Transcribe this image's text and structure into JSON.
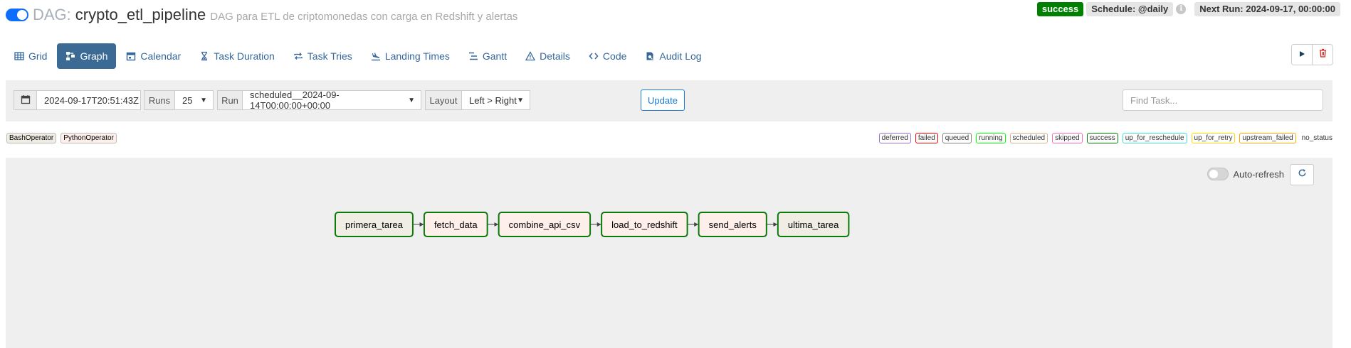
{
  "header": {
    "dag_prefix": "DAG:",
    "dag_id": "crypto_etl_pipeline",
    "description": "DAG para ETL de criptomonedas con carga en Redshift y alertas",
    "status": "success",
    "schedule": "Schedule: @daily",
    "info_glyph": "i",
    "next_run": "Next Run: 2024-09-17, 00:00:00",
    "toggle_state": "on",
    "status_color": "#008000"
  },
  "tabs": [
    {
      "label": "Grid",
      "icon": "grid-icon",
      "active": false
    },
    {
      "label": "Graph",
      "icon": "graph-icon",
      "active": true
    },
    {
      "label": "Calendar",
      "icon": "calendar-icon",
      "active": false
    },
    {
      "label": "Task Duration",
      "icon": "hourglass-icon",
      "active": false
    },
    {
      "label": "Task Tries",
      "icon": "retry-icon",
      "active": false
    },
    {
      "label": "Landing Times",
      "icon": "landing-icon",
      "active": false
    },
    {
      "label": "Gantt",
      "icon": "gantt-icon",
      "active": false
    },
    {
      "label": "Details",
      "icon": "warning-triangle-icon",
      "active": false
    },
    {
      "label": "Code",
      "icon": "code-icon",
      "active": false
    },
    {
      "label": "Audit Log",
      "icon": "audit-log-icon",
      "active": false
    }
  ],
  "actions": {
    "trigger_icon": "play-icon",
    "delete_icon": "trash-icon"
  },
  "filters": {
    "base_date": "2024-09-17T20:51:43Z",
    "runs_label": "Runs",
    "runs_value": "25",
    "run_label": "Run",
    "run_value": "scheduled__2024-09-14T00:00:00+00:00",
    "layout_label": "Layout",
    "layout_value": "Left > Right",
    "update_label": "Update",
    "find_placeholder": "Find Task..."
  },
  "operators": [
    {
      "label": "BashOperator",
      "color": "#f0ede4"
    },
    {
      "label": "PythonOperator",
      "color": "#ffefeb"
    }
  ],
  "states": [
    {
      "label": "deferred",
      "color": "#9370db"
    },
    {
      "label": "failed",
      "color": "#ff0000"
    },
    {
      "label": "queued",
      "color": "#808080"
    },
    {
      "label": "running",
      "color": "#00ff00"
    },
    {
      "label": "scheduled",
      "color": "#d2b48c"
    },
    {
      "label": "skipped",
      "color": "#ff69b4"
    },
    {
      "label": "success",
      "color": "#008000"
    },
    {
      "label": "up_for_reschedule",
      "color": "#40e0d0"
    },
    {
      "label": "up_for_retry",
      "color": "#ffd700"
    },
    {
      "label": "upstream_failed",
      "color": "#ffa500"
    }
  ],
  "no_status": "no_status",
  "graph": {
    "autorefresh_label": "Auto-refresh",
    "node_border_color": "#0b7a0b",
    "nodes": [
      {
        "id": "primera_tarea",
        "operator": "BashOperator"
      },
      {
        "id": "fetch_data",
        "operator": "PythonOperator"
      },
      {
        "id": "combine_api_csv",
        "operator": "PythonOperator"
      },
      {
        "id": "load_to_redshift",
        "operator": "PythonOperator"
      },
      {
        "id": "send_alerts",
        "operator": "PythonOperator"
      },
      {
        "id": "ultima_tarea",
        "operator": "BashOperator"
      }
    ],
    "edges": [
      [
        "primera_tarea",
        "fetch_data"
      ],
      [
        "fetch_data",
        "combine_api_csv"
      ],
      [
        "combine_api_csv",
        "load_to_redshift"
      ],
      [
        "load_to_redshift",
        "send_alerts"
      ],
      [
        "send_alerts",
        "ultima_tarea"
      ]
    ]
  }
}
